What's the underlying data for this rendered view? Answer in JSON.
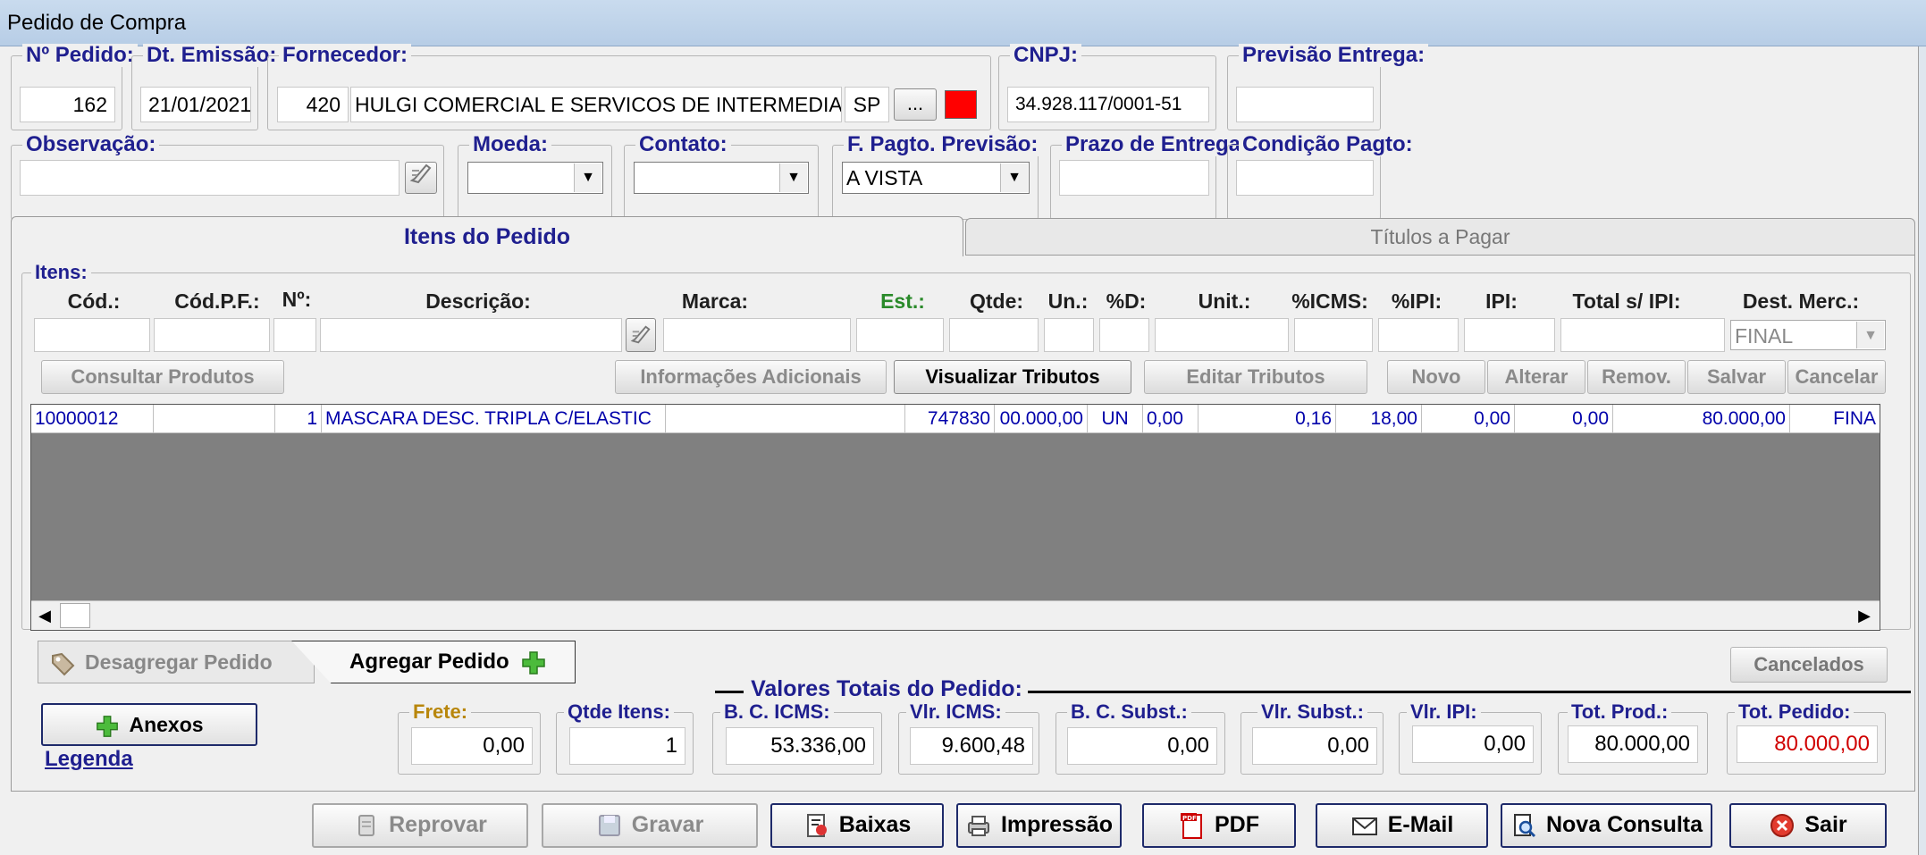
{
  "window": {
    "title": "Pedido de Compra"
  },
  "header": {
    "pedido": {
      "label": "Nº Pedido:",
      "value": "162"
    },
    "emissao": {
      "label": "Dt. Emissão:",
      "value": "21/01/2021"
    },
    "fornecedor": {
      "label": "Fornecedor:",
      "code": "420",
      "name": "HULGI COMERCIAL E SERVICOS DE INTERMEDIACOES DE NEGOCIOS",
      "uf": "SP",
      "browse": "...",
      "color": "#ff0000"
    },
    "cnpj": {
      "label": "CNPJ:",
      "value": "34.928.117/0001-51"
    },
    "previsao": {
      "label": "Previsão Entrega:",
      "value": ""
    },
    "observacao": {
      "label": "Observação:",
      "value": ""
    },
    "moeda": {
      "label": "Moeda:",
      "value": ""
    },
    "contato": {
      "label": "Contato:",
      "value": ""
    },
    "fpagto": {
      "label": "F. Pagto. Previsão:",
      "value": "A VISTA"
    },
    "prazo": {
      "label": "Prazo de Entrega:",
      "value": ""
    },
    "condicao": {
      "label": "Condição Pagto:",
      "value": ""
    }
  },
  "tabs": {
    "itens": "Itens do Pedido",
    "titulos": "Títulos a Pagar"
  },
  "itens": {
    "label": "Itens:",
    "columns": {
      "cod": "Cód.:",
      "codpf": "Cód.P.F.:",
      "num": "Nº:",
      "descricao": "Descrição:",
      "marca": "Marca:",
      "est": "Est.:",
      "qtde": "Qtde:",
      "un": "Un.:",
      "pd": "%D:",
      "unit": "Unit.:",
      "icms": "%ICMS:",
      "pipi": "%IPI:",
      "ipi": "IPI:",
      "total": "Total s/ IPI:",
      "dest": "Dest. Merc.:"
    },
    "dest_value": "FINAL",
    "buttons": {
      "consultar": "Consultar Produtos",
      "info": "Informações Adicionais",
      "visualizar": "Visualizar Tributos",
      "editar": "Editar Tributos",
      "novo": "Novo",
      "alterar": "Alterar",
      "remov": "Remov.",
      "salvar": "Salvar",
      "cancelar": "Cancelar"
    },
    "row": {
      "cod": "10000012",
      "codpf": "",
      "num": "1",
      "descricao": "MASCARA DESC. TRIPLA C/ELASTIC",
      "marca": "",
      "est": "747830",
      "qtde": "00.000,00",
      "un": "UN",
      "pd": "0,00",
      "unit": "0,16",
      "icms": "18,00",
      "pipi": "0,00",
      "ipi": "0,00",
      "total": "80.000,00",
      "dest": "FINA"
    }
  },
  "agregar": {
    "desagregar": "Desagregar Pedido",
    "agregar": "Agregar Pedido",
    "cancelados": "Cancelados"
  },
  "anexos": {
    "label": "Anexos",
    "legenda": "Legenda"
  },
  "totais": {
    "title": "Valores Totais do Pedido:",
    "frete": {
      "label": "Frete:",
      "value": "0,00"
    },
    "qtde": {
      "label": "Qtde Itens:",
      "value": "1"
    },
    "bcicms": {
      "label": "B. C. ICMS:",
      "value": "53.336,00"
    },
    "vlricms": {
      "label": "Vlr. ICMS:",
      "value": "9.600,48"
    },
    "bcsubst": {
      "label": "B. C. Subst.:",
      "value": "0,00"
    },
    "vlrsubst": {
      "label": "Vlr. Subst.:",
      "value": "0,00"
    },
    "vlripi": {
      "label": "Vlr. IPI:",
      "value": "0,00"
    },
    "totprod": {
      "label": "Tot. Prod.:",
      "value": "80.000,00"
    },
    "totpedido": {
      "label": "Tot. Pedido:",
      "value": "80.000,00"
    }
  },
  "footer": {
    "reprovar": "Reprovar",
    "gravar": "Gravar",
    "baixas": "Baixas",
    "impressao": "Impressão",
    "pdf": "PDF",
    "pdf_badge": "PDF",
    "email": "E-Mail",
    "nova": "Nova Consulta",
    "sair": "Sair"
  }
}
